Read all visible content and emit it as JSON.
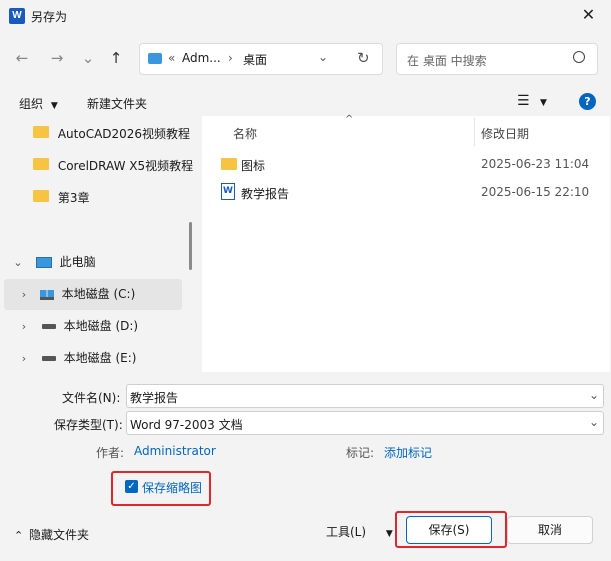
{
  "window": {
    "title": "另存为",
    "app_icon": "W",
    "close_label": "✕"
  },
  "nav": {
    "back": "←",
    "forward": "→",
    "history": "⌄",
    "up": "↑",
    "breadcrumb_sep": "«",
    "path": [
      "Adm...",
      "桌面"
    ],
    "refresh": "↻",
    "search_placeholder": "在 桌面 中搜索"
  },
  "toolbar": {
    "organize": "组织",
    "new_folder": "新建文件夹"
  },
  "sidebar": {
    "items": [
      {
        "label": "AutoCAD2026视频教程"
      },
      {
        "label": "CorelDRAW X5视频教程"
      },
      {
        "label": "第3章"
      },
      {
        "label": "此电脑"
      },
      {
        "label": "本地磁盘 (C:)"
      },
      {
        "label": "本地磁盘 (D:)"
      },
      {
        "label": "本地磁盘 (E:)"
      }
    ]
  },
  "files": {
    "col_name": "名称",
    "col_date": "修改日期",
    "rows": [
      {
        "name": "图标",
        "date": "2025-06-23 11:04",
        "type": "folder"
      },
      {
        "name": "教学报告",
        "date": "2025-06-15 22:10",
        "type": "word"
      }
    ]
  },
  "form": {
    "filename_label": "文件名(N):",
    "filename_value": "教学报告",
    "type_label": "保存类型(T):",
    "type_value": "Word 97-2003 文档",
    "author_label": "作者:",
    "author_value": "Administrator",
    "tags_label": "标记:",
    "tags_value": "添加标记",
    "thumbnail_label": "保存缩略图",
    "thumbnail_checked": true
  },
  "footer": {
    "hide_folders": "隐藏文件夹",
    "tools": "工具(L)",
    "save": "保存(S)",
    "cancel": "取消"
  },
  "colors": {
    "accent": "#0067c0",
    "highlight": "#e0262b",
    "selected_bg": "#e5e5e5"
  }
}
